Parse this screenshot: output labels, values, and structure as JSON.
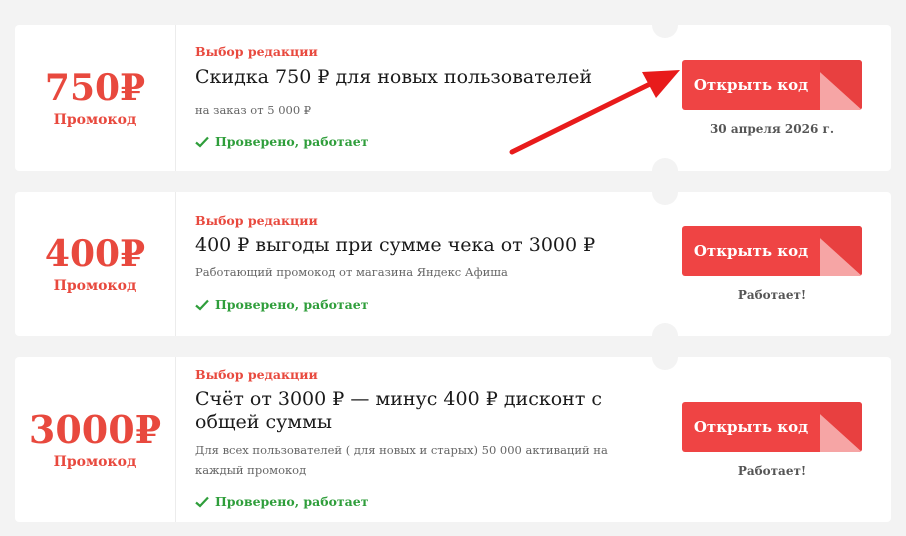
{
  "colors": {
    "accent": "#e8493e",
    "verified": "#2f9e3b",
    "button": "#ef4444",
    "arrow": "#e81b1b"
  },
  "offers": [
    {
      "amount": "750₽",
      "type_label": "Промокод",
      "editor_label": "Выбор редакции",
      "title": "Скидка 750 ₽ для новых пользователей",
      "subtitle": "на заказ от 5 000 ₽",
      "verified_label": "Проверено, работает",
      "button_label": "Открыть код",
      "meta": "30 апреля 2026 г."
    },
    {
      "amount": "400₽",
      "type_label": "Промокод",
      "editor_label": "Выбор редакции",
      "title": "400 ₽ выгоды при сумме чека от 3000 ₽",
      "subtitle": "Работающий промокод от магазина Яндекс Афиша",
      "verified_label": "Проверено, работает",
      "button_label": "Открыть код",
      "meta": "Работает!"
    },
    {
      "amount": "3000₽",
      "type_label": "Промокод",
      "editor_label": "Выбор редакции",
      "title": "Счёт от 3000 ₽ — минус 400 ₽ дисконт с общей суммы",
      "subtitle": "Для всех пользователей ( для новых и старых) 50 000 активаций на каждый промокод",
      "verified_label": "Проверено, работает",
      "button_label": "Открыть код",
      "meta": "Работает!"
    }
  ]
}
